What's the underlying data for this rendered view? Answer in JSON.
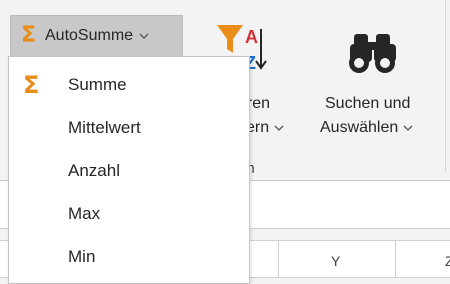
{
  "ribbon": {
    "autosum": {
      "label": "AutoSumme",
      "icon": "sigma-icon"
    },
    "sort_filter": {
      "line1": "eren",
      "line2": "ern",
      "icon": "sort-filter-icon"
    },
    "find_select": {
      "line1": "Suchen und",
      "line2": "Auswählen",
      "icon": "binoculars-icon"
    },
    "group_label_fragment": "en"
  },
  "menu": {
    "items": [
      {
        "label": "Summe",
        "icon": "sigma-icon"
      },
      {
        "label": "Mittelwert"
      },
      {
        "label": "Anzahl"
      },
      {
        "label": "Max"
      },
      {
        "label": "Min"
      }
    ]
  },
  "sheet": {
    "columns": [
      "Y",
      "Z"
    ]
  },
  "colors": {
    "accent_orange": "#e98c18",
    "sort_blue": "#1f6fc5",
    "sort_red": "#d13438"
  }
}
